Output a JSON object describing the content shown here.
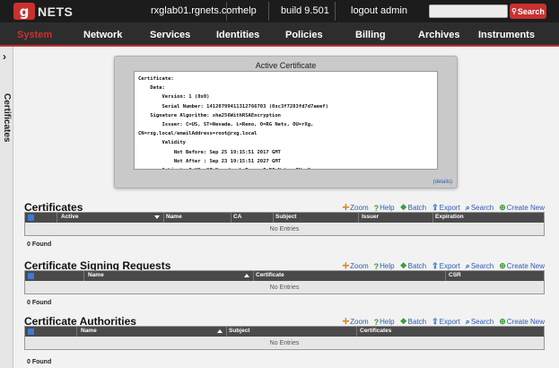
{
  "topbar": {
    "logo_mark": "g",
    "logo_text": "NETS",
    "hostname": "rxglab01.rgnets.com",
    "help": "help",
    "build": "build 9.501",
    "logout": "logout admin",
    "search_placeholder": "",
    "search_button": "Search"
  },
  "nav": {
    "items": [
      "System",
      "Network",
      "Services",
      "Identities",
      "Policies",
      "Billing",
      "Archives",
      "Instruments"
    ],
    "active": "System"
  },
  "sidebar": {
    "label": "Certificates"
  },
  "active_certificate": {
    "title": "Active Certificate",
    "text": "Certificate:\n    Data:\n        Version: 1 (0x0)\n        Serial Number: 14120799411312766703 (0xc3f7283fd7d7aeef)\n    Signature Algorithm: sha256WithRSAEncryption\n        Issuer: C=US, ST=Nevada, L=Reno, O=RG Nets, OU=rXg,\nCN=rxg.local/emailAddress=root@rxg.local\n        Validity\n            Not Before: Sep 25 19:15:51 2017 GMT\n            Not After : Sep 23 19:15:51 2027 GMT\n        Subject: C=US, ST=Nevada, L=Reno, O=RG Nets, OU=rXg,",
    "details_link": "(details)"
  },
  "actions": {
    "zoom": "Zoom",
    "help": "Help",
    "batch": "Batch",
    "export": "Export",
    "search": "Search",
    "create_new": "Create New"
  },
  "sections": {
    "certificates": {
      "title": "Certificates",
      "columns": [
        "Active",
        "Name",
        "CA",
        "Subject",
        "Issuer",
        "Expiration"
      ],
      "empty": "No Entries",
      "found": "0 Found"
    },
    "csr": {
      "title": "Certificate Signing Requests",
      "columns": [
        "Name",
        "Certificate",
        "CSR"
      ],
      "empty": "No Entries",
      "found": "0 Found"
    },
    "authorities": {
      "title": "Certificate Authorities",
      "columns": [
        "Name",
        "Subject",
        "Certificates"
      ],
      "empty": "No Entries",
      "found": "0 Found"
    }
  }
}
